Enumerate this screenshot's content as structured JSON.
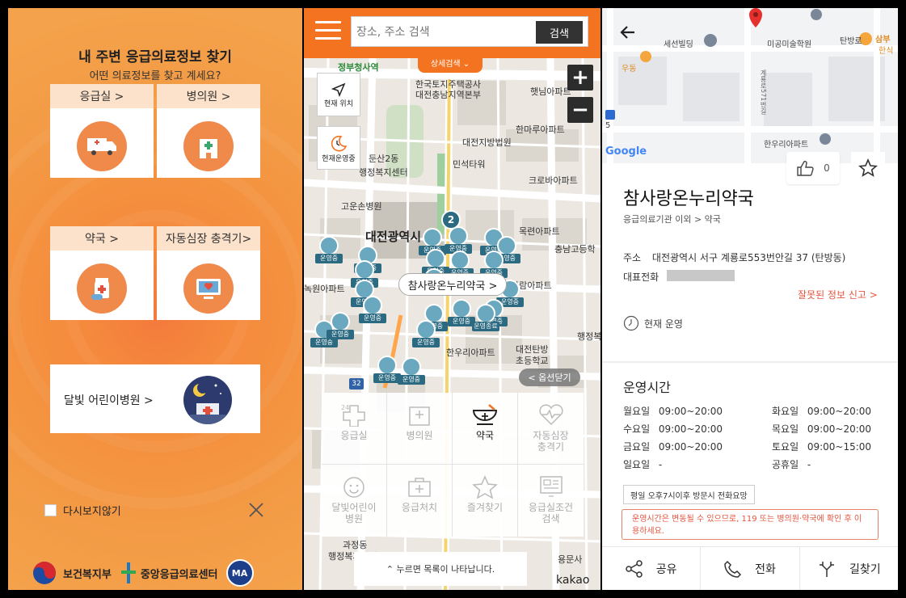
{
  "panel1": {
    "title": "내 주변 응급의료정보 찾기",
    "subtitle": "어떤 의료정보를 찾고 계세요?",
    "cards": [
      {
        "label": "응급실 >",
        "icon": "ambulance-icon"
      },
      {
        "label": "병의원 >",
        "icon": "hospital-icon"
      },
      {
        "label": "약국 >",
        "icon": "medicine-icon"
      },
      {
        "label": "자동심장 충격기>",
        "icon": "defibrillator-icon"
      }
    ],
    "night_card": {
      "label": "달빛 어린이병원 >",
      "icon": "moon-hospital-icon"
    },
    "dont_show_label": "다시보지않기",
    "footer": {
      "ministry": "보건복지부",
      "center": "중앙응급의료센터",
      "ma": "MA"
    }
  },
  "panel2": {
    "search_placeholder": "장소, 주소 검색",
    "search_button": "검색",
    "detail_search": "상세검색 ⌄",
    "current_location": "현재 위치",
    "operating_filter": "현재운영중",
    "map_labels": {
      "jeongbu": "정부청사역",
      "lh": "한국토지주택공사",
      "lh2": "대전충남지역본부",
      "haetnim": "햇님아파트",
      "hanmaru": "한마루아파트",
      "court": "대전지방법원",
      "dunsan": "둔산2동",
      "dunsan2": "행정복지센터",
      "minseok": "민석타워",
      "crova": "크로바아파트",
      "gojin": "고운손병원",
      "city_hall": "대전광역시",
      "mokryeon": "목련아파트",
      "chungnam": "충남고등학",
      "nokwon": "녹원아파트",
      "garam": "가람아파트",
      "hanwoori": "한우리아파트",
      "tanbang": "대전탄방",
      "tanbang2": "초등학교",
      "haengjeong": "행정복",
      "gwajeong": "과정동",
      "gwajeong2": "행정복지센터",
      "yongmun": "용문사"
    },
    "pin_label": "운영중",
    "pin_label_end": "운영종료",
    "cluster_count": "2",
    "road_num": "32",
    "callout": "참사랑온누리약국 >",
    "option_close": "< 옵션닫기",
    "categories": [
      {
        "label": "응급실",
        "icon": "emergency-24-icon"
      },
      {
        "label": "병의원",
        "icon": "hospital-icon"
      },
      {
        "label": "약국",
        "icon": "pharmacy-bowl-icon",
        "selected": true
      },
      {
        "label": "자동심장\n충격기",
        "icon": "heart-pulse-icon"
      },
      {
        "label": "달빛어린이\n병원",
        "icon": "child-face-icon"
      },
      {
        "label": "응급처치",
        "icon": "first-aid-kit-icon"
      },
      {
        "label": "즐겨찾기",
        "icon": "star-icon"
      },
      {
        "label": "응급실조건\n검색",
        "icon": "monitor-search-icon"
      }
    ],
    "bottom_bar": "⌃ 누르면 목록이 나타납니다.",
    "kakao": "kakao"
  },
  "panel3": {
    "map_labels": {
      "sesun": "세선빌딩",
      "migong": "미공미술학원",
      "tanbang": "탄방로",
      "samboo": "삼부",
      "hansik": "한식",
      "woodong": "우동",
      "hanwoori": "한우리아파트",
      "gyeryong": "계룡로571번길",
      "left5": "5"
    },
    "google": "Google",
    "like_count": "0",
    "name": "참사랑온누리약국",
    "category": "응급의료기관 이외 > 약국",
    "address_label": "주소",
    "address": "대전광역시 서구 계룡로553번안길 37 (탄방동)",
    "phone_label": "대표전화",
    "report": "잘못된 정보 신고 >",
    "status": "현재 운영",
    "hours_title": "운영시간",
    "hours": [
      {
        "day": "월요일",
        "time": "09:00~20:00"
      },
      {
        "day": "화요일",
        "time": "09:00~20:00"
      },
      {
        "day": "수요일",
        "time": "09:00~20:00"
      },
      {
        "day": "목요일",
        "time": "09:00~20:00"
      },
      {
        "day": "금요일",
        "time": "09:00~20:00"
      },
      {
        "day": "토요일",
        "time": "09:00~15:00"
      },
      {
        "day": "일요일",
        "time": "-"
      },
      {
        "day": "공휴일",
        "time": "-"
      }
    ],
    "note": "평일 오후7시이후 방문시 전화요망",
    "warning": "운영시간은 변동될 수 있으므로, 119 또는 병의원·약국에 확인 후 이용하세요.",
    "actions": [
      {
        "label": "공유",
        "icon": "share-icon"
      },
      {
        "label": "전화",
        "icon": "phone-icon"
      },
      {
        "label": "길찾기",
        "icon": "directions-icon"
      }
    ]
  },
  "colors": {
    "orange": "#f37321",
    "pin": "#6aa8bf",
    "accent_red": "#e4553e"
  }
}
